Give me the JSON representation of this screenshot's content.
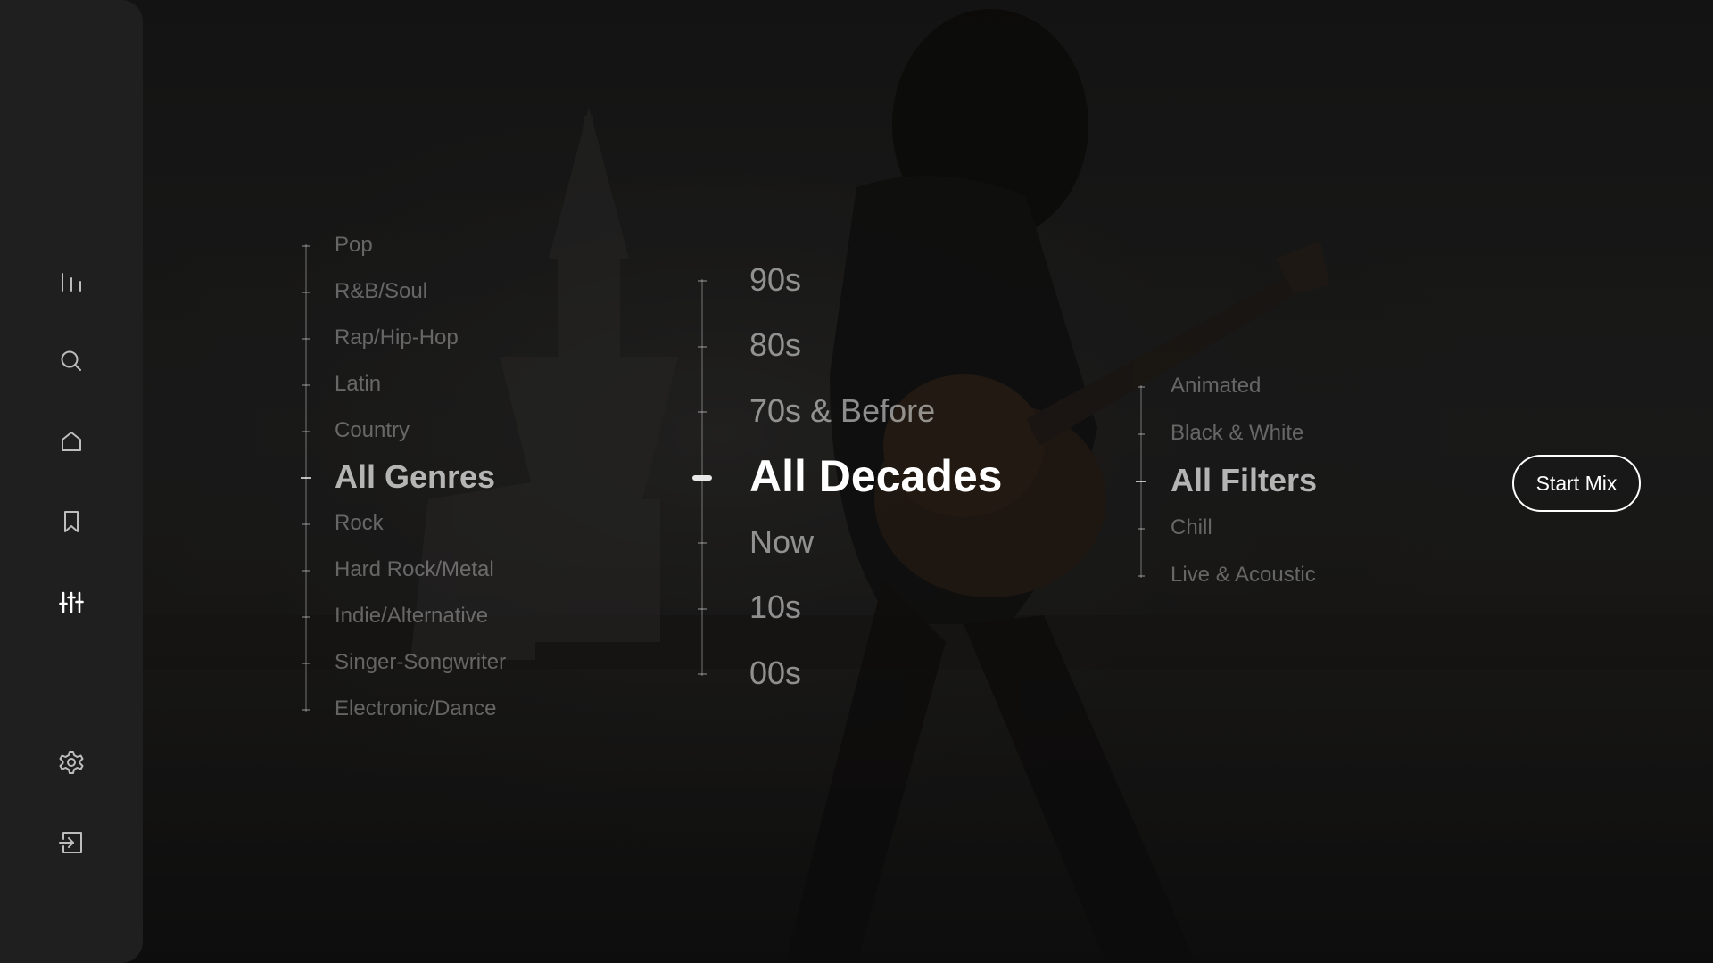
{
  "sidebar": {
    "items": [
      {
        "icon": "equalizer-bars-icon"
      },
      {
        "icon": "search-icon"
      },
      {
        "icon": "home-icon"
      },
      {
        "icon": "bookmark-icon"
      },
      {
        "icon": "mixer-sliders-icon",
        "active": true
      },
      {
        "icon": "gear-icon"
      },
      {
        "icon": "sign-in-icon"
      }
    ]
  },
  "genres": {
    "options": [
      "Pop",
      "R&B/Soul",
      "Rap/Hip-Hop",
      "Latin",
      "Country",
      "All Genres",
      "Rock",
      "Hard Rock/Metal",
      "Indie/Alternative",
      "Singer-Songwriter",
      "Electronic/Dance"
    ],
    "selected": "All Genres"
  },
  "decades": {
    "options": [
      "90s",
      "80s",
      "70s & Before",
      "All Decades",
      "Now",
      "10s",
      "00s"
    ],
    "selected": "All Decades"
  },
  "filters": {
    "options": [
      "Animated",
      "Black & White",
      "All Filters",
      "Chill",
      "Live & Acoustic"
    ],
    "selected": "All Filters"
  },
  "start_button": {
    "label": "Start Mix"
  },
  "colors": {
    "sidebar_bg": "#1f1f1f",
    "selected_text": "#ffffff",
    "unselected_text": "#5a5a5a"
  }
}
